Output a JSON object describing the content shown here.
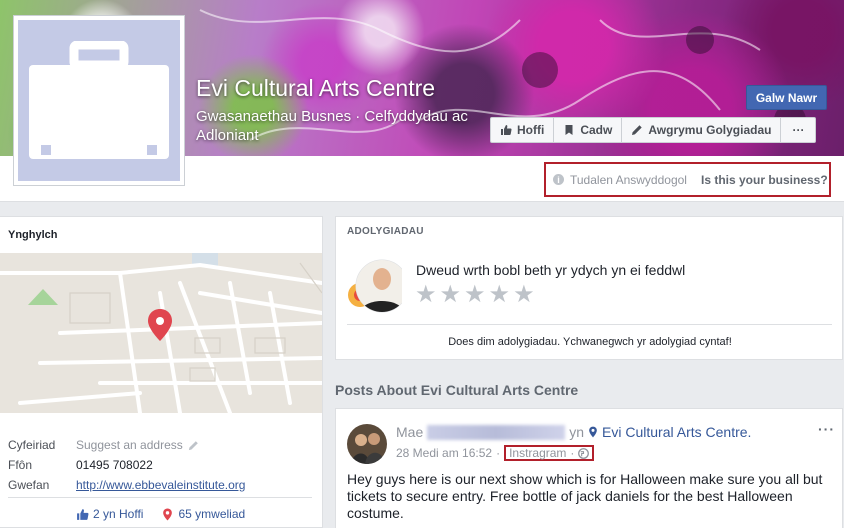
{
  "page": {
    "name": "Evi Cultural Arts Centre",
    "category": "Gwasanaethau Busnes · Celfyddydau ac Adloniant"
  },
  "header_actions": {
    "call_now": "Galw Nawr",
    "like": "Hoffi",
    "save": "Cadw",
    "suggest_edits": "Awgrymu Golygiadau",
    "more": "···"
  },
  "unofficial": {
    "label": "Tudalen Answyddogol",
    "claim_link": "Is this your business?"
  },
  "about": {
    "heading": "Ynghylch",
    "rows": [
      {
        "key": "Cyfeiriad",
        "value": "Suggest an address"
      },
      {
        "key": "Ffôn",
        "value": "01495 708022"
      },
      {
        "key": "Gwefan",
        "value": "http://www.ebbevaleinstitute.org"
      }
    ],
    "likes": "2 yn Hoffi",
    "visits": "65 ymweliad"
  },
  "reviews": {
    "heading": "ADOLYGIADAU",
    "prompt": "Dweud wrth bobl beth yr ydych yn ei feddwl",
    "empty": "Does dim adolygiadau. Ychwanegwch yr adolygiad cyntaf!",
    "stars": 5
  },
  "posts": {
    "heading": "Posts About Evi Cultural Arts Centre",
    "post": {
      "prefix": "Mae",
      "in_word": "yn",
      "place": "Evi Cultural Arts Centre.",
      "timestamp": "28 Medi am 16:52",
      "source": "Instragram",
      "text": "Hey guys here is our next show which is for Halloween make sure you all but tickets to secure entry. Free bottle of jack daniels for the best Halloween costume.",
      "more": "···"
    }
  },
  "colors": {
    "brand_blue": "#4267b2",
    "link": "#365899",
    "highlight_red": "#b2202b",
    "map_pin": "#e0454f"
  }
}
